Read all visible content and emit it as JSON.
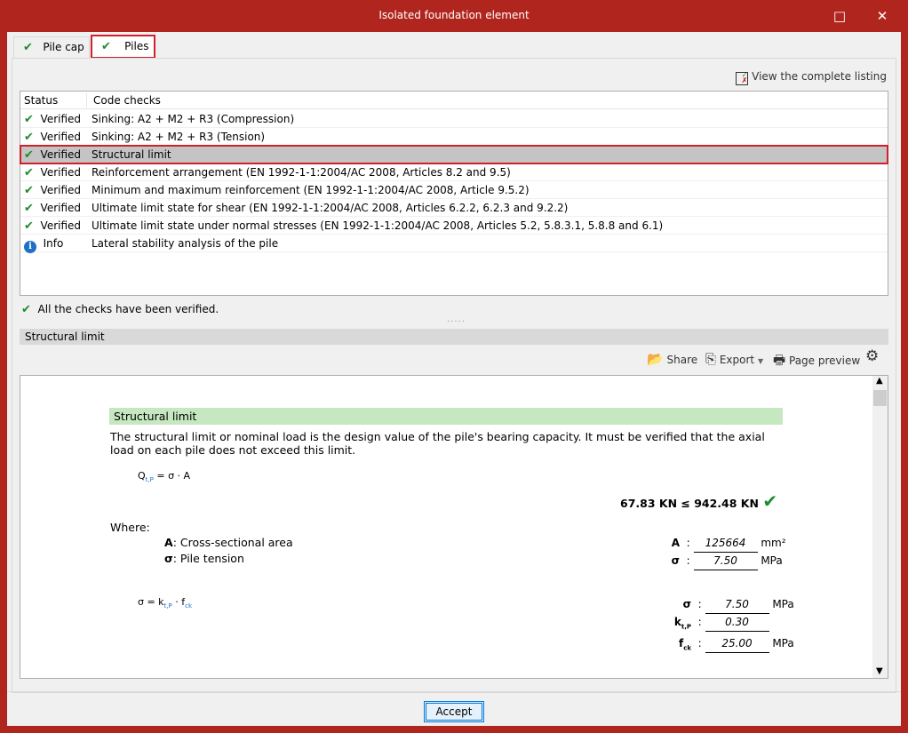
{
  "window": {
    "title": "Isolated foundation element",
    "maximize_icon": "□",
    "close_icon": "✕"
  },
  "tabs": [
    {
      "label": "Pile cap",
      "icon": "check-icon"
    },
    {
      "label": "Piles",
      "icon": "check-icon"
    }
  ],
  "listing_label": "View the complete listing",
  "table": {
    "headers": [
      "Status",
      "Code checks"
    ],
    "rows": [
      {
        "status": "Verified",
        "check": "Sinking: A2 + M2 + R3 (Compression)"
      },
      {
        "status": "Verified",
        "check": "Sinking: A2 + M2 + R3 (Tension)"
      },
      {
        "status": "Verified",
        "check": "Structural limit"
      },
      {
        "status": "Verified",
        "check": "Reinforcement arrangement (EN 1992-1-1:2004/AC 2008, Articles 8.2 and 9.5)"
      },
      {
        "status": "Verified",
        "check": "Minimum and maximum reinforcement (EN 1992-1-1:2004/AC 2008, Article 9.5.2)"
      },
      {
        "status": "Verified",
        "check": "Ultimate limit state for shear (EN 1992-1-1:2004/AC 2008, Articles 6.2.2, 6.2.3 and 9.2.2)"
      },
      {
        "status": "Verified",
        "check": "Ultimate limit state under normal stresses (EN 1992-1-1:2004/AC 2008, Articles 5.2, 5.8.3.1, 5.8.8 and 6.1)"
      },
      {
        "status": "Info",
        "check": "Lateral stability analysis of the pile"
      }
    ]
  },
  "summary": "All the checks have been verified.",
  "section_title": "Structural limit",
  "toolbar": {
    "share": "Share",
    "export": "Export",
    "page_preview": "Page preview"
  },
  "report": {
    "heading": "Structural limit",
    "intro": "The structural limit or nominal load is the design value of the pile's bearing capacity. It must be verified that the axial load on each pile does not exceed this limit.",
    "formula1": {
      "lhs": "Q",
      "sub": "t,P",
      "rhs": "= σ · A"
    },
    "result": "67.83 KN ≤ 942.48 KN",
    "where": "Where:",
    "defs": [
      {
        "sym": "A",
        "desc": ": Cross-sectional area"
      },
      {
        "sym": "σ",
        "desc": ": Pile tension"
      }
    ],
    "vals1": [
      {
        "sym": "A",
        "value": "125664",
        "unit": "mm²"
      },
      {
        "sym": "σ",
        "value": "7.50",
        "unit": "MPa"
      }
    ],
    "formula2": {
      "lhs": "σ = k",
      "sub1": "t,P",
      "mid": " · f",
      "sub2": "ck"
    },
    "vals2": [
      {
        "sym": "σ",
        "sub": "",
        "value": "7.50",
        "unit": "MPa"
      },
      {
        "sym": "k",
        "sub": "t,P",
        "value": "0.30",
        "unit": ""
      },
      {
        "sym": "f",
        "sub": "ck",
        "value": "25.00",
        "unit": "MPa"
      }
    ]
  },
  "accept": "Accept"
}
